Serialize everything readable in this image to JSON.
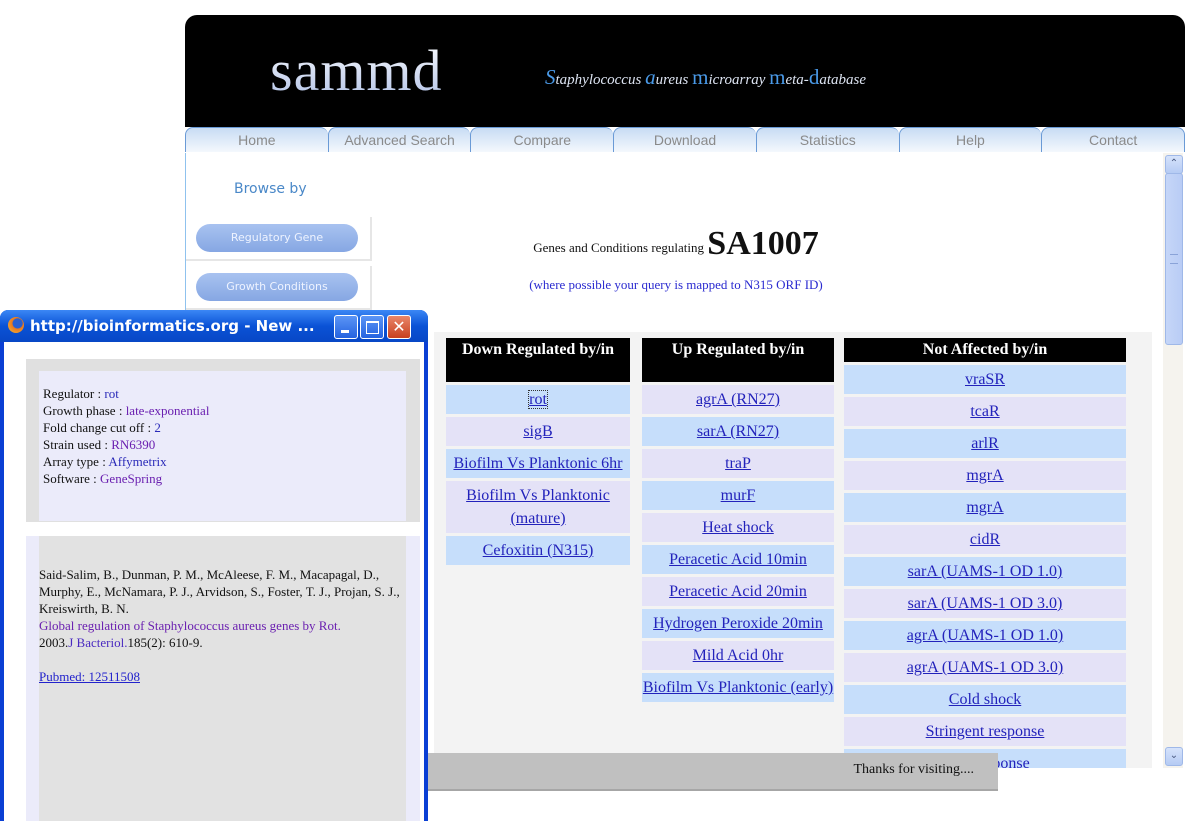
{
  "header": {
    "logo": "sammd",
    "tagline": [
      {
        "cap": "S",
        "rest": "taphylococcus "
      },
      {
        "cap": "a",
        "rest": "ureus "
      },
      {
        "cap": "m",
        "rest": "icroarray "
      },
      {
        "cap": "m",
        "rest": "eta-"
      },
      {
        "cap": "d",
        "rest": "atabase"
      }
    ]
  },
  "nav": {
    "tabs": [
      "Home",
      "Advanced Search",
      "Compare",
      "Download",
      "Statistics",
      "Help",
      "Contact"
    ]
  },
  "sidebar": {
    "heading": "Browse by",
    "buttons": [
      "Regulatory Gene",
      "Growth Conditions"
    ]
  },
  "query": {
    "prefix": "Genes and Conditions regulating",
    "gene": "SA1007",
    "note": "(where possible your query is mapped to N315 ORF ID)"
  },
  "tables": {
    "down": {
      "header": "Down Regulated by/in",
      "items": [
        "rot",
        "sigB",
        "Biofilm Vs Planktonic 6hr",
        "Biofilm Vs Planktonic (mature)",
        "Cefoxitin (N315)"
      ]
    },
    "up": {
      "header": "Up Regulated by/in",
      "items": [
        "agrA (RN27)",
        "sarA (RN27)",
        "traP",
        "murF",
        "Heat shock",
        "Peracetic Acid 10min",
        "Peracetic Acid 20min",
        "Hydrogen Peroxide 20min",
        "Mild Acid 0hr",
        "Biofilm Vs Planktonic (early)"
      ]
    },
    "not_affected": {
      "header": "Not Affected by/in",
      "items": [
        "vraSR",
        "tcaR",
        "arlR",
        "mgrA",
        "mgrA",
        "cidR",
        "sarA (UAMS-1 OD 1.0)",
        "sarA (UAMS-1 OD 3.0)",
        "agrA (UAMS-1 OD 1.0)",
        "agrA (UAMS-1 OD 3.0)",
        "Cold shock",
        "Stringent response",
        "SOS response"
      ]
    }
  },
  "footer": {
    "text": "Thanks for visiting...."
  },
  "popup": {
    "title": "http://bioinformatics.org - New ...",
    "close_glyph": "✕",
    "details": [
      {
        "label": "Regulator : ",
        "value": "rot",
        "style": "v"
      },
      {
        "label": "Growth phase : ",
        "value": "late-exponential",
        "style": "p"
      },
      {
        "label": "Fold change cut off : ",
        "value": "2",
        "style": "v"
      },
      {
        "label": "Strain used : ",
        "value": "RN6390",
        "style": "p"
      },
      {
        "label": "Array type : ",
        "value": "Affymetrix",
        "style": "v"
      },
      {
        "label": "Software : ",
        "value": "GeneSpring",
        "style": "p"
      }
    ],
    "reference": {
      "authors": "Said-Salim, B., Dunman, P. M., McAleese, F. M., Macapagal, D., Murphy, E., McNamara, P. J., Arvidson, S., Foster, T. J., Projan, S. J., Kreiswirth, B. N.",
      "title": "Global regulation of Staphylococcus aureus genes by Rot.",
      "year": "2003.",
      "journal": "J Bacteriol.",
      "citation": "185(2): 610-9.",
      "pubmed": "Pubmed: 12511508"
    }
  },
  "scrollbar": {
    "up_glyph": "⌃",
    "down_glyph": "⌄"
  }
}
